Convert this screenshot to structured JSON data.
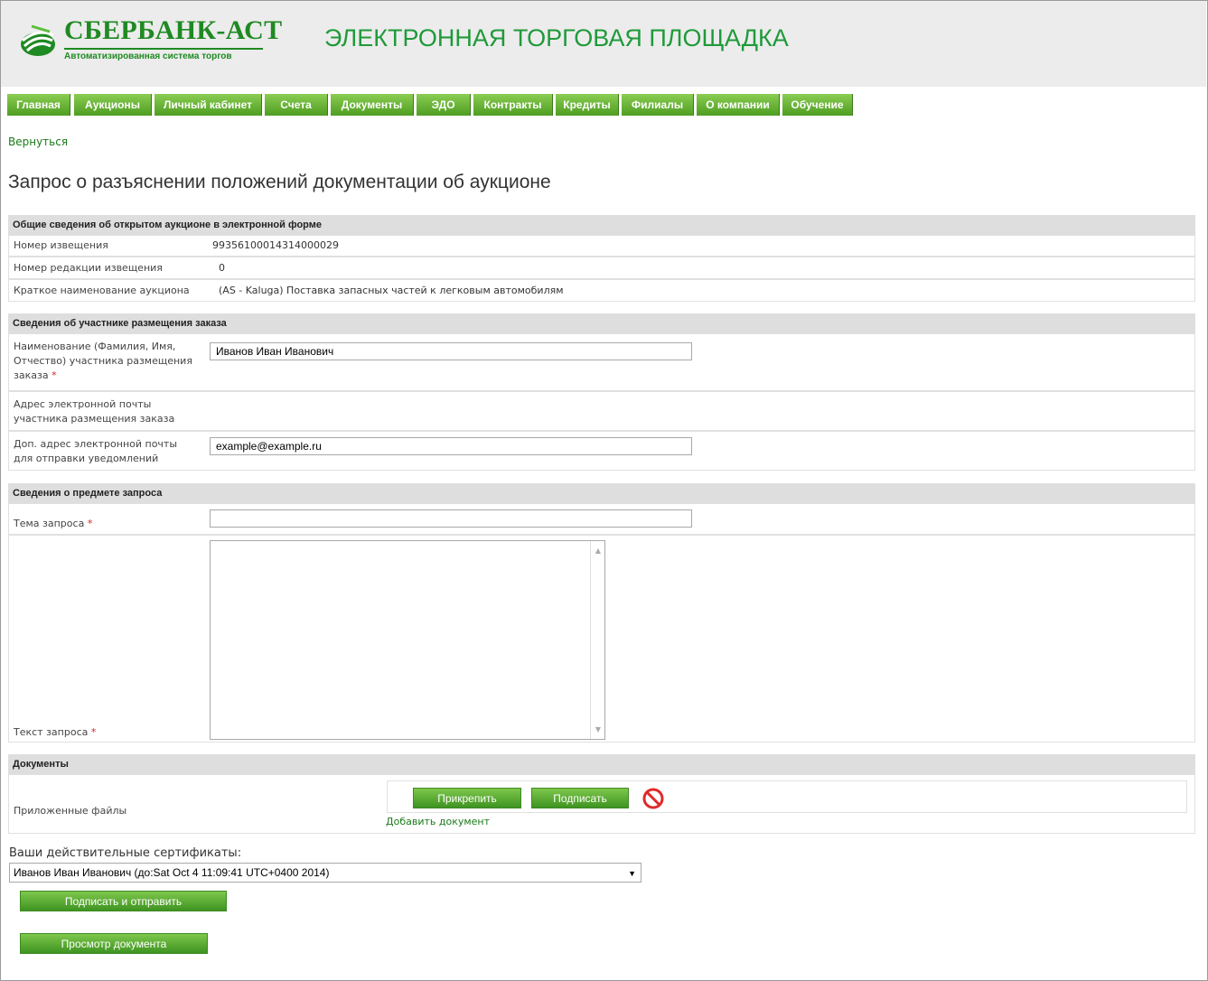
{
  "header": {
    "logo_name": "СБЕРБАНК-АСТ",
    "logo_sub": "Автоматизированная система торгов",
    "site_title": "ЭЛЕКТРОННАЯ ТОРГОВАЯ ПЛОЩАДКА"
  },
  "nav": {
    "tabs": [
      "Главная",
      "Аукционы",
      "Личный кабинет",
      "Счета",
      "Документы",
      "ЭДО",
      "Контракты",
      "Кредиты",
      "Филиалы",
      "О компании",
      "Обучение"
    ]
  },
  "back_link": "Вернуться",
  "page_title": "Запрос о разъяснении положений документации об аукционе",
  "auction": {
    "header": "Общие сведения об открытом аукционе в электронной форме",
    "notice_label": "Номер извещения",
    "notice_value": "99356100014314000029",
    "revision_label": "Номер редакции извещения",
    "revision_value": "0",
    "shortname_label": "Краткое наименование аукциона",
    "shortname_value": "(AS - Kaluga) Поставка запасных частей к легковым автомобилям"
  },
  "participant": {
    "header": "Сведения об участнике размещения заказа",
    "name_label_1": "Наименование (Фамилия, Имя,",
    "name_label_2": "Отчество) участника размещения",
    "name_label_3": "заказа",
    "name_value": "Иванов Иван Иванович",
    "email_label_1": "Адрес электронной почты",
    "email_label_2": "участника размещения заказа",
    "extra_email_label_1": "Доп. адрес электронной почты",
    "extra_email_label_2": "для отправки уведомлений",
    "extra_email_value": "example@example.ru"
  },
  "request": {
    "header": "Сведения о предмете запроса",
    "subject_label": "Тема запроса",
    "subject_value": "",
    "text_label": "Текст запроса",
    "required_mark": "*"
  },
  "documents": {
    "header": "Документы",
    "files_label": "Приложенные файлы",
    "attach_button": "Прикрепить",
    "sign_button": "Подписать",
    "add_document": "Добавить документ"
  },
  "certificates": {
    "label": "Ваши действительные сертификаты:",
    "selected": "Иванов Иван Иванович (до:Sat Oct 4 11:09:41 UTC+0400 2014)"
  },
  "actions": {
    "sign_send": "Подписать и отправить",
    "preview": "Просмотр документа"
  },
  "colors": {
    "brand": "#1f8a22",
    "nav_tab": "#5fae2e",
    "required": "#dd2222"
  }
}
